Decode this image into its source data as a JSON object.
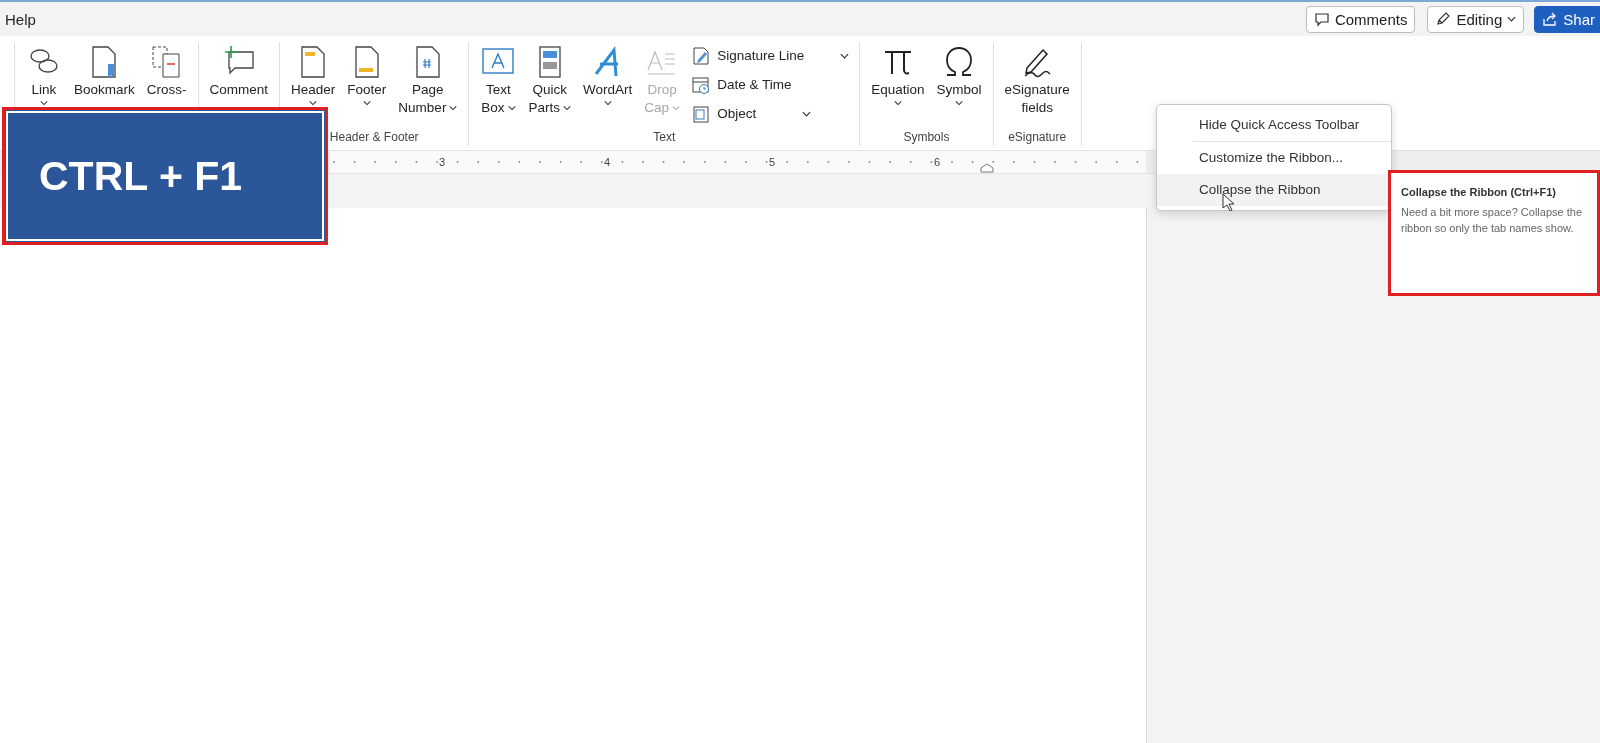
{
  "tabs": [
    {
      "label": "Help"
    }
  ],
  "header_buttons": [
    {
      "label": "Comments",
      "kind": "comments"
    },
    {
      "label": "Editing",
      "kind": "editing"
    },
    {
      "label": "Shar",
      "kind": "share"
    }
  ],
  "ribbon": {
    "groups": [
      {
        "buttons": [
          {
            "lines": [
              "Link"
            ],
            "dropdown": true,
            "disabled": false
          },
          {
            "lines": [
              "Bookmark"
            ],
            "dropdown": false,
            "disabled": false
          },
          {
            "lines": [
              "Cross-"
            ],
            "dropdown": false,
            "disabled": false
          }
        ]
      },
      {
        "buttons": [
          {
            "lines": [
              "Comment"
            ],
            "dropdown": false,
            "disabled": false
          }
        ]
      },
      {
        "label": "Header & Footer",
        "buttons": [
          {
            "lines": [
              "Header"
            ],
            "dropdown": true,
            "disabled": false
          },
          {
            "lines": [
              "Footer"
            ],
            "dropdown": true,
            "disabled": false
          },
          {
            "lines": [
              "Page",
              "Number"
            ],
            "dropdown": true,
            "disabled": false
          }
        ]
      },
      {
        "label": "Text",
        "buttons": [
          {
            "lines": [
              "Text",
              "Box"
            ],
            "dropdown": true,
            "disabled": false
          },
          {
            "lines": [
              "Quick",
              "Parts"
            ],
            "dropdown": true,
            "disabled": false
          },
          {
            "lines": [
              "WordArt"
            ],
            "dropdown": true,
            "disabled": false
          },
          {
            "lines": [
              "Drop",
              "Cap"
            ],
            "dropdown": true,
            "disabled": true
          }
        ],
        "small_buttons": [
          {
            "label": "Signature Line",
            "dropdown": true
          },
          {
            "label": "Date & Time",
            "dropdown": false
          },
          {
            "label": "Object",
            "dropdown": true
          }
        ]
      },
      {
        "label": "Symbols",
        "buttons": [
          {
            "lines": [
              "Equation"
            ],
            "dropdown": true,
            "disabled": false
          },
          {
            "lines": [
              "Symbol"
            ],
            "dropdown": true,
            "disabled": false
          }
        ]
      },
      {
        "label": "eSignature",
        "buttons": [
          {
            "lines": [
              "eSignature",
              "fields"
            ],
            "dropdown": false,
            "disabled": false
          }
        ]
      }
    ]
  },
  "ruler": {
    "numbers": [
      "3",
      "4",
      "5",
      "6"
    ]
  },
  "shortcut_callout": {
    "text": "CTRL + F1"
  },
  "context_menu": {
    "items": [
      {
        "label": "Hide Quick Access Toolbar",
        "highlighted": false,
        "separator_after": true
      },
      {
        "label": "Customize the Ribbon...",
        "highlighted": false,
        "separator_after": false
      },
      {
        "label": "Collapse the Ribbon",
        "highlighted": true,
        "separator_after": false
      }
    ]
  },
  "tooltip": {
    "title": "Collapse the Ribbon (Ctrl+F1)",
    "text": "Need a bit more space? Collapse the ribbon so only the tab names show."
  }
}
